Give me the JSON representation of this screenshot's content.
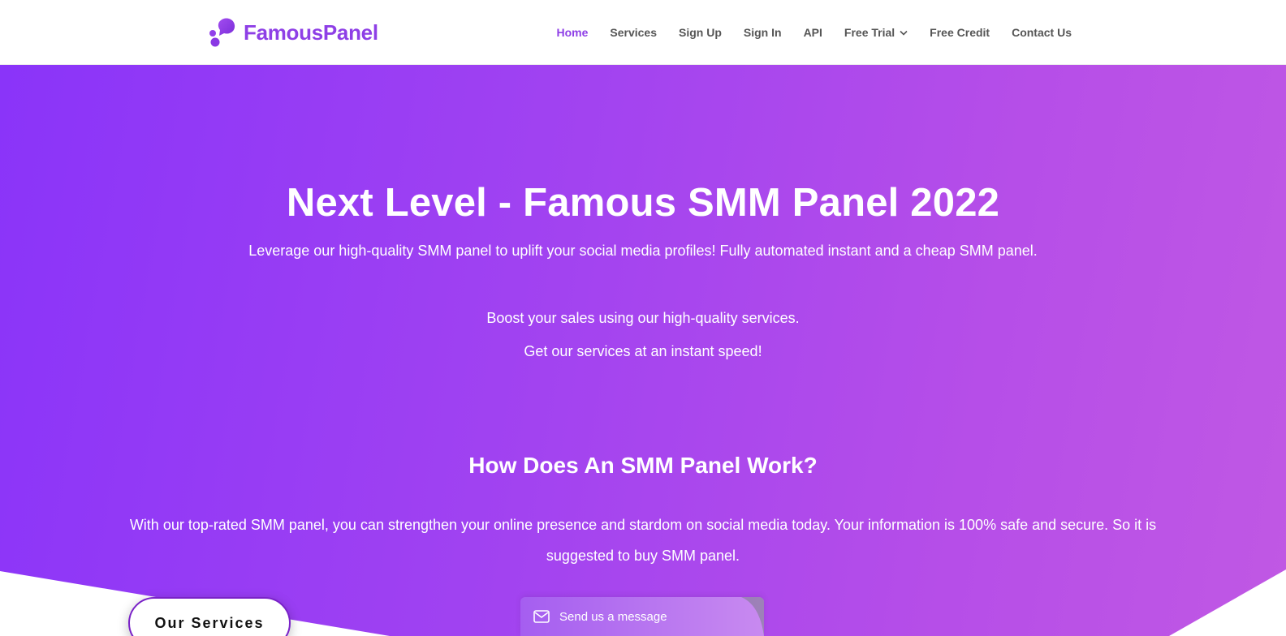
{
  "header": {
    "logo_text": "FamousPanel",
    "nav": [
      {
        "label": "Home",
        "active": true
      },
      {
        "label": "Services"
      },
      {
        "label": "Sign Up"
      },
      {
        "label": "Sign In"
      },
      {
        "label": "API"
      },
      {
        "label": "Free Trial",
        "has_dropdown": true
      },
      {
        "label": "Free Credit"
      },
      {
        "label": "Contact Us"
      }
    ]
  },
  "hero": {
    "title": "Next Level - Famous SMM Panel 2022",
    "subtitle": "Leverage our high-quality SMM panel to uplift your social media profiles! Fully automated instant and a cheap SMM panel.",
    "line1": "Boost your sales using our high-quality services.",
    "line2": "Get our services at an instant speed!",
    "how_title": "How Does An SMM Panel Work?",
    "how_text": "With our top-rated SMM panel, you can strengthen your online presence and stardom on social media today. Your information is 100% safe and secure. So it is suggested to buy SMM panel.",
    "cta_label": "Our Services"
  },
  "chat_widget": {
    "label": "Send us a message",
    "icon": "envelope-icon"
  },
  "colors": {
    "brand": "#8e3fe6",
    "gradient_start": "#8a34f9",
    "gradient_end": "#c058e4",
    "nav_text": "#555555"
  }
}
